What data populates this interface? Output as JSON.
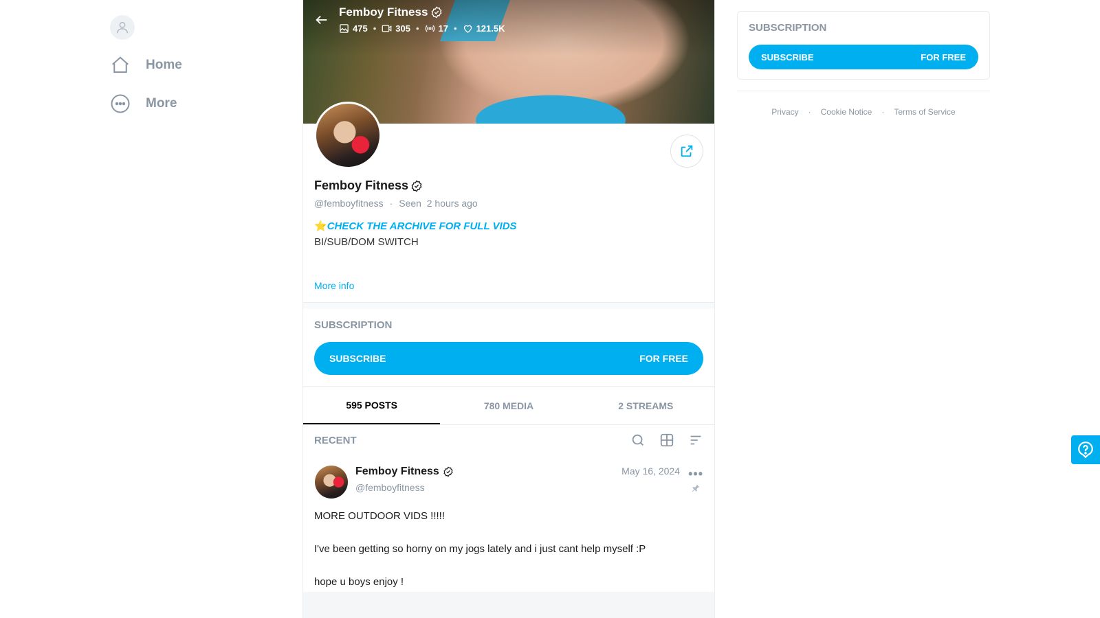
{
  "nav": {
    "items": [
      {
        "label": "Home",
        "icon": "home-icon"
      },
      {
        "label": "More",
        "icon": "more-icon"
      }
    ]
  },
  "profile": {
    "name": "Femboy Fitness",
    "handle": "@femboyfitness",
    "seen_label": "Seen",
    "seen_time": "2 hours ago",
    "stats": {
      "photos": "475",
      "videos": "305",
      "streams": "17",
      "likes": "121.5K"
    },
    "bio_highlight": "CHECK THE ARCHIVE FOR FULL VIDS",
    "bio_line2": "BI/SUB/DOM SWITCH",
    "more_info": "More info"
  },
  "subscription": {
    "label": "SUBSCRIPTION",
    "button_left": "SUBSCRIBE",
    "button_right": "FOR FREE"
  },
  "tabs": [
    {
      "label": "595 POSTS",
      "active": true
    },
    {
      "label": "780 MEDIA",
      "active": false
    },
    {
      "label": "2 STREAMS",
      "active": false
    }
  ],
  "feed": {
    "section_label": "RECENT",
    "post": {
      "author": "Femboy Fitness",
      "handle": "@femboyfitness",
      "date": "May 16, 2024",
      "lines": [
        "MORE OUTDOOR VIDS !!!!!",
        "I've been getting so horny on my jogs lately and i just cant help myself :P",
        "hope u boys enjoy !"
      ]
    }
  },
  "right": {
    "subscription_label": "SUBSCRIPTION",
    "button_left": "SUBSCRIBE",
    "button_right": "FOR FREE",
    "footer_links": [
      "Privacy",
      "Cookie Notice",
      "Terms of Service"
    ],
    "footer_separator": "·"
  },
  "colors": {
    "accent": "#00aff0",
    "muted": "#8a96a3"
  }
}
